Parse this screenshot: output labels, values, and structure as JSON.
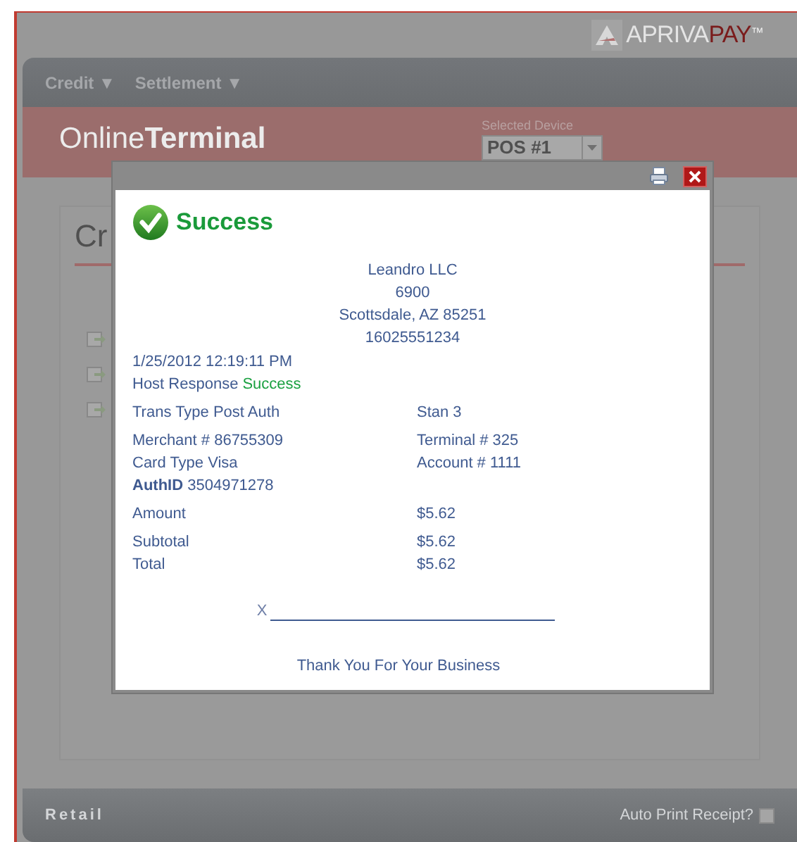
{
  "brand": {
    "light": "APRIVA",
    "bold": "PAY",
    "mark": "™"
  },
  "nav": [
    {
      "label": "Credit",
      "caret": "▼"
    },
    {
      "label": "Settlement",
      "caret": "▼"
    }
  ],
  "banner": {
    "logo_light": "Online",
    "logo_bold": "Terminal",
    "device_label": "Selected Device",
    "device_value": "POS #1"
  },
  "panel": {
    "heading": "Cr"
  },
  "dialog": {
    "title": "Success",
    "merchant_lines": [
      "Leandro LLC",
      "6900",
      "Scottsdale, AZ 85251",
      "16025551234"
    ],
    "datetime": "1/25/2012 12:19:11 PM",
    "host_response": {
      "label": "Host Response",
      "value": "Success"
    },
    "groups": [
      [
        {
          "left": "Trans Type Post Auth",
          "right": "Stan 3"
        }
      ],
      [
        {
          "left": "Merchant # 86755309",
          "right": "Terminal # 325"
        },
        {
          "left": "Card Type Visa",
          "right": "Account # 1111"
        },
        {
          "left": "**AuthID** 3504971278"
        }
      ],
      [
        {
          "left": "Amount",
          "right": "$5.62"
        }
      ],
      [
        {
          "left": "Subtotal",
          "right": "$5.62"
        },
        {
          "left": "Total",
          "right": "$5.62"
        }
      ]
    ],
    "signature_mark": "X",
    "footer": "Thank You For Your Business"
  },
  "footer": {
    "section": "Retail",
    "auto_print": {
      "label": "Auto Print Receipt?",
      "checked": false
    }
  }
}
